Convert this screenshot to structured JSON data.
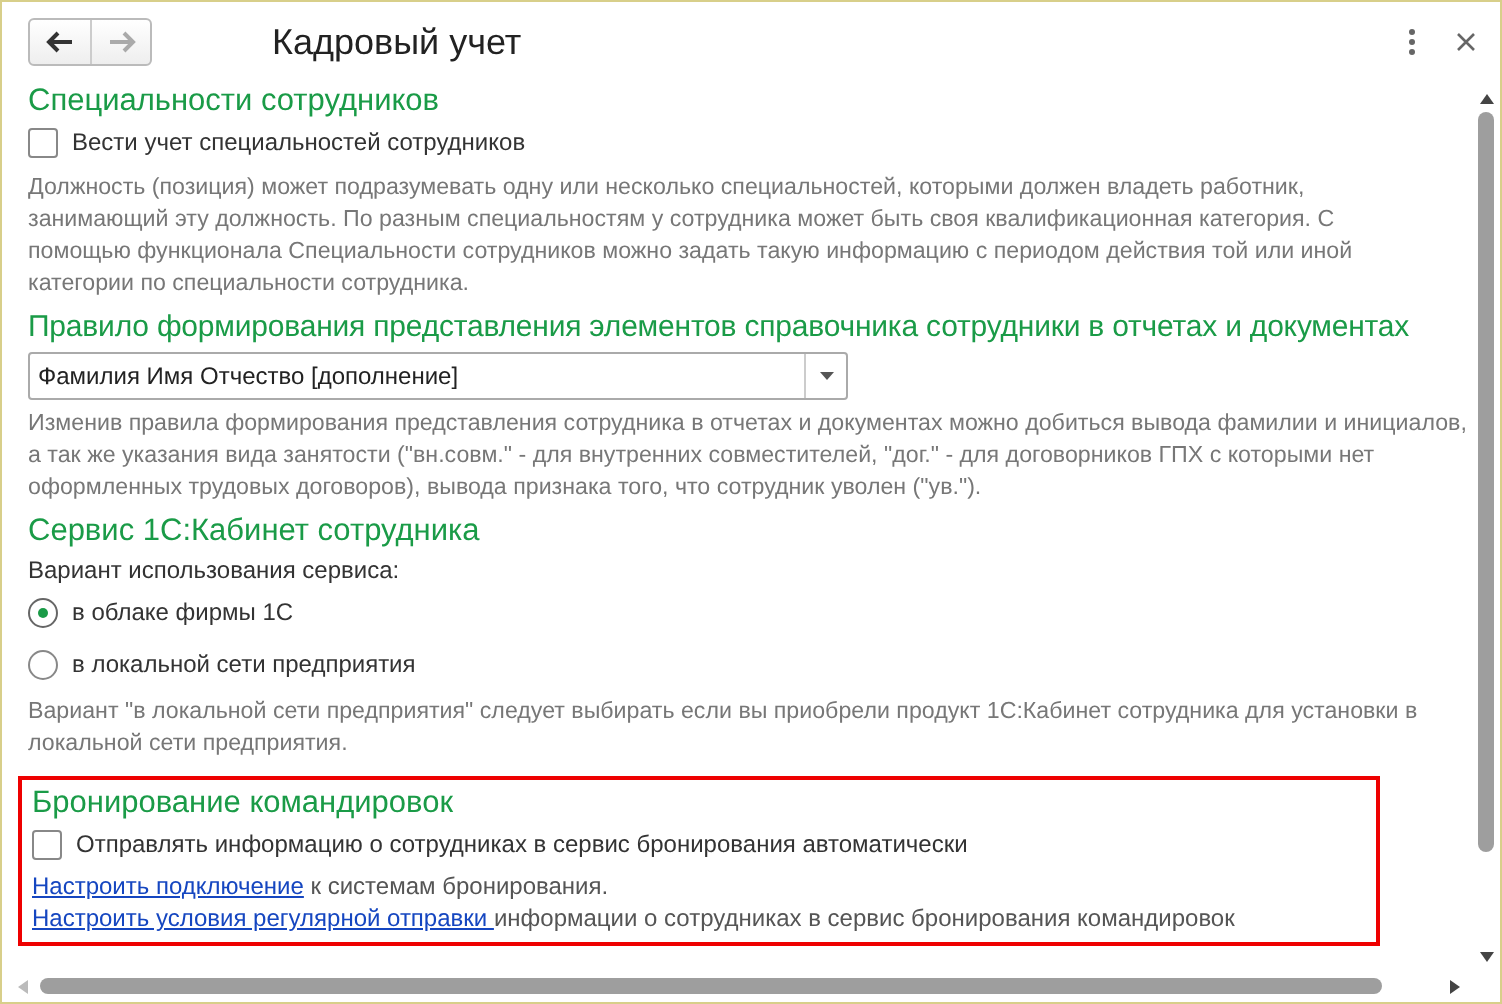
{
  "window": {
    "title": "Кадровый учет"
  },
  "nav": [
    {
      "kind": "back",
      "disabled": false
    },
    {
      "kind": "forward",
      "disabled": true
    }
  ],
  "specialties": {
    "heading": "Специальности сотрудников",
    "checkbox": {
      "label": "Вести учет специальностей сотрудников",
      "checked": false
    },
    "note": "Должность (позиция) может подразумевать одну или несколько специальностей, которыми должен владеть работник, занимающий эту должность. По разным специальностям у сотрудника может быть своя квалификационная категория. С помощью функционала Специальности сотрудников можно задать такую информацию с периодом действия той или иной категории по специальности сотрудника."
  },
  "naming_rule": {
    "heading": "Правило формирования представления элементов справочника сотрудники в отчетах и документах",
    "select": {
      "value": "Фамилия Имя Отчество [дополнение]"
    },
    "note": "Изменив правила формирования представления сотрудника в отчетах и документах можно добиться вывода фамилии и инициалов, а так же указания вида занятости (\"вн.совм.\" - для внутренних совместителей, \"дог.\" - для договорников ГПХ с которыми нет оформленных трудовых договоров), вывода признака того, что сотрудник уволен (\"ув.\")."
  },
  "cabinet": {
    "heading": "Сервис 1С:Кабинет сотрудника",
    "label": "Вариант использования сервиса:",
    "options": [
      {
        "label": "в облаке фирмы 1С",
        "selected": true
      },
      {
        "label": "в локальной сети предприятия",
        "selected": false
      }
    ],
    "note": "Вариант \"в локальной сети предприятия\" следует выбирать если вы приобрели продукт 1С:Кабинет сотрудника для установки в локальной сети предприятия."
  },
  "booking": {
    "highlighted": true,
    "heading": "Бронирование командировок",
    "checkbox": {
      "label": "Отправлять информацию о сотрудниках в сервис бронирования автоматически",
      "checked": false
    },
    "links": [
      {
        "link": "Настроить подключение",
        "text": " к системам бронирования."
      },
      {
        "link": "Настроить условия регулярной отправки ",
        "text": "информации о сотрудниках в сервис бронирования командировок"
      }
    ]
  }
}
